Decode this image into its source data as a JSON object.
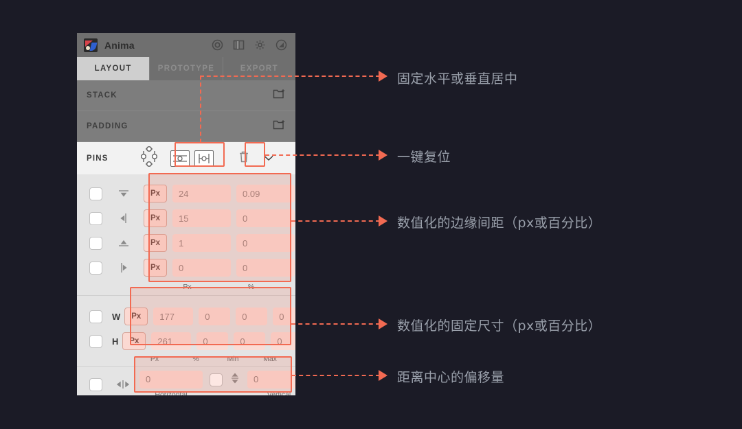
{
  "colors": {
    "background": "#1b1b26",
    "accent": "#f26a52",
    "annotation_text": "#9aa0ab",
    "panel_body": "#e4e4e4",
    "field_bg": "#fbdbd4"
  },
  "panel": {
    "app_title": "Anima",
    "logo_icon": "anima-logo-icon",
    "header_icons": [
      {
        "name": "target-icon"
      },
      {
        "name": "split-panel-icon"
      },
      {
        "name": "gear-icon"
      },
      {
        "name": "disable-circle-icon"
      }
    ],
    "tabs": [
      {
        "label": "LAYOUT",
        "active": true
      },
      {
        "label": "PROTOTYPE",
        "active": false
      },
      {
        "label": "EXPORT",
        "active": false
      }
    ],
    "sections": [
      {
        "label": "STACK",
        "action_icon": "add-folder-icon"
      },
      {
        "label": "PADDING",
        "action_icon": "add-folder-icon"
      }
    ],
    "pins": {
      "label": "PINS",
      "anchor_icon": "pin-anchor-icon",
      "center_buttons": [
        {
          "name": "center-vertical-button"
        },
        {
          "name": "center-horizontal-button"
        }
      ],
      "reset_icon": "trash-icon",
      "expand_icon": "chevron-down-icon",
      "rows": [
        {
          "direction_icon": "pin-top-icon",
          "unit": "Px",
          "px": "24",
          "percent": "0.09",
          "checked": false
        },
        {
          "direction_icon": "pin-right-icon",
          "unit": "Px",
          "px": "15",
          "percent": "0",
          "checked": false
        },
        {
          "direction_icon": "pin-bottom-icon",
          "unit": "Px",
          "px": "1",
          "percent": "0",
          "checked": false
        },
        {
          "direction_icon": "pin-left-icon",
          "unit": "Px",
          "px": "0",
          "percent": "0",
          "checked": false
        }
      ],
      "column_labels": [
        "Px",
        "%"
      ]
    },
    "size": {
      "rows": [
        {
          "label": "W",
          "unit": "Px",
          "px": "177",
          "percent": "0",
          "min": "0",
          "max": "0",
          "checked": false
        },
        {
          "label": "H",
          "unit": "Px",
          "px": "261",
          "percent": "0",
          "min": "0",
          "max": "0",
          "checked": false
        }
      ],
      "column_labels": [
        "Px",
        "%",
        "Min",
        "Max"
      ]
    },
    "offset": {
      "icon": "center-offset-icon",
      "horizontal_value": "0",
      "horizontal_label": "Horizontal",
      "vertical_value": "0",
      "vertical_label": "Vertical",
      "link_icon": "updown-stepper-icon",
      "checked": false
    }
  },
  "annotations": [
    {
      "text": "固定水平或垂直居中"
    },
    {
      "text": "一键复位"
    },
    {
      "text": "数值化的边缘间距（px或百分比）"
    },
    {
      "text": "数值化的固定尺寸（px或百分比）"
    },
    {
      "text": "距离中心的偏移量"
    }
  ]
}
